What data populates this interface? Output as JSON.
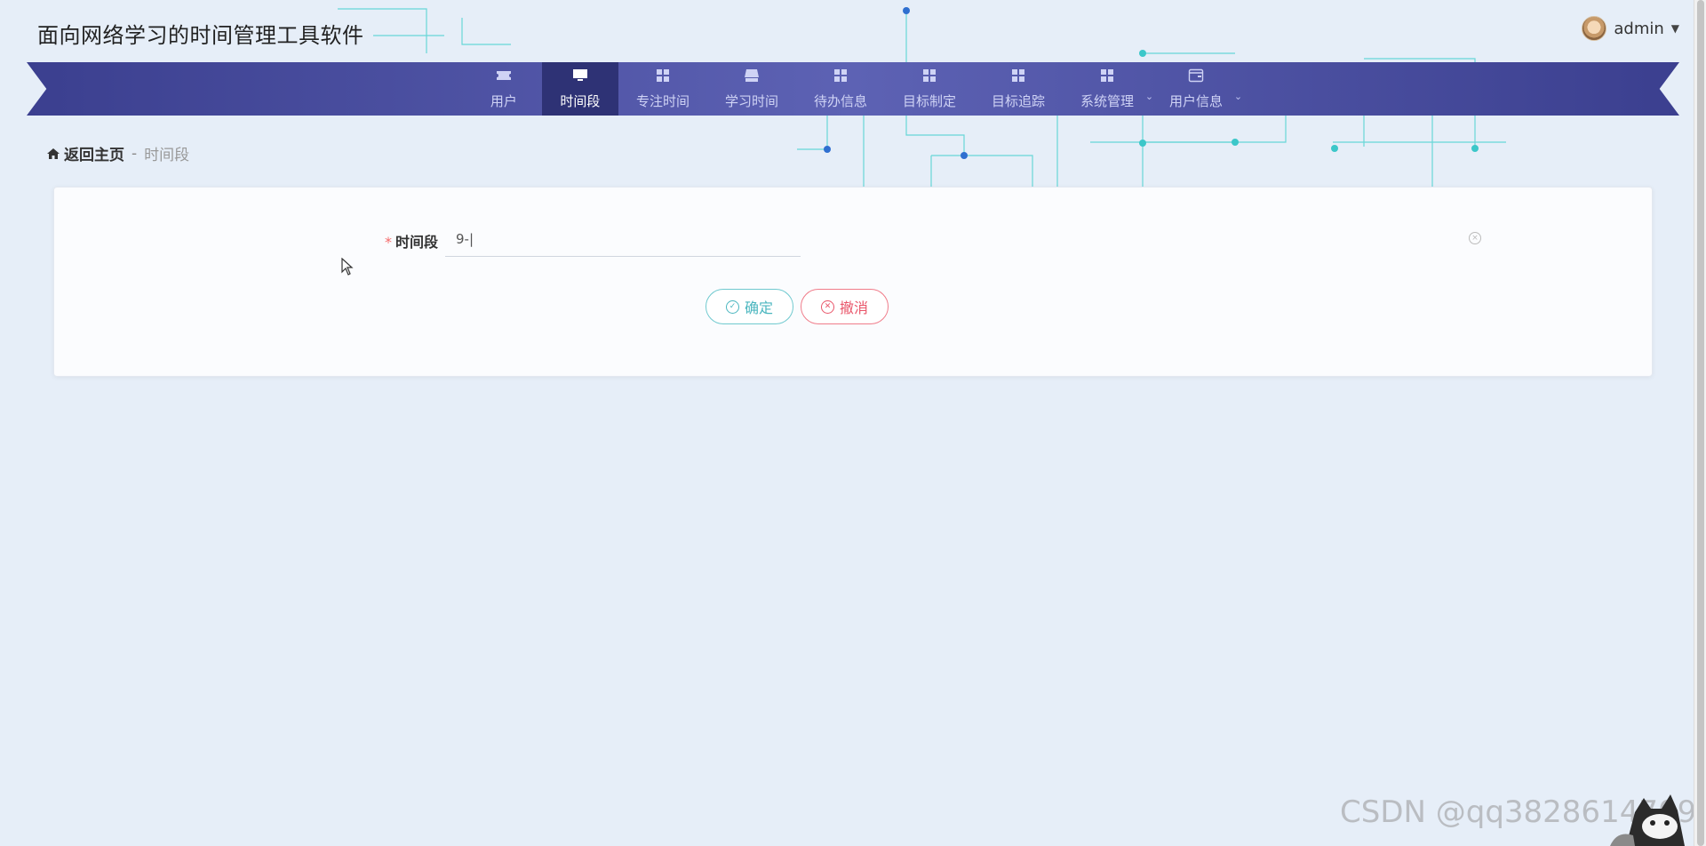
{
  "app": {
    "title": "面向网络学习的时间管理工具软件"
  },
  "user": {
    "name": "admin",
    "caret": "▼"
  },
  "nav": {
    "items": [
      {
        "label": "用户",
        "icon": "ticket-icon",
        "active": false,
        "dropdown": false
      },
      {
        "label": "时间段",
        "icon": "monitor-icon",
        "active": true,
        "dropdown": false
      },
      {
        "label": "专注时间",
        "icon": "grid-icon",
        "active": false,
        "dropdown": false
      },
      {
        "label": "学习时间",
        "icon": "shelf-icon",
        "active": false,
        "dropdown": false
      },
      {
        "label": "待办信息",
        "icon": "grid-icon",
        "active": false,
        "dropdown": false
      },
      {
        "label": "目标制定",
        "icon": "grid-icon",
        "active": false,
        "dropdown": false
      },
      {
        "label": "目标追踪",
        "icon": "grid-icon",
        "active": false,
        "dropdown": false
      },
      {
        "label": "系统管理",
        "icon": "grid-icon",
        "active": false,
        "dropdown": true
      },
      {
        "label": "用户信息",
        "icon": "wallet-icon",
        "active": false,
        "dropdown": true
      }
    ],
    "dropdown_glyph": "⌄"
  },
  "breadcrumb": {
    "home": "返回主页",
    "separator": "-",
    "current": "时间段"
  },
  "form": {
    "required_mark": "*",
    "field_label": "时间段",
    "field_value": "9-|",
    "clear_glyph": "×",
    "confirm_label": "确定",
    "cancel_label": "撤消"
  },
  "watermark": "CSDN @qq3828614709",
  "colors": {
    "nav_bg": "#4a4fa3",
    "nav_active": "#2e3275",
    "page_bg": "#e6eef8",
    "confirm": "#4ab6bf",
    "cancel": "#e9566a",
    "required": "#f56c6c"
  }
}
